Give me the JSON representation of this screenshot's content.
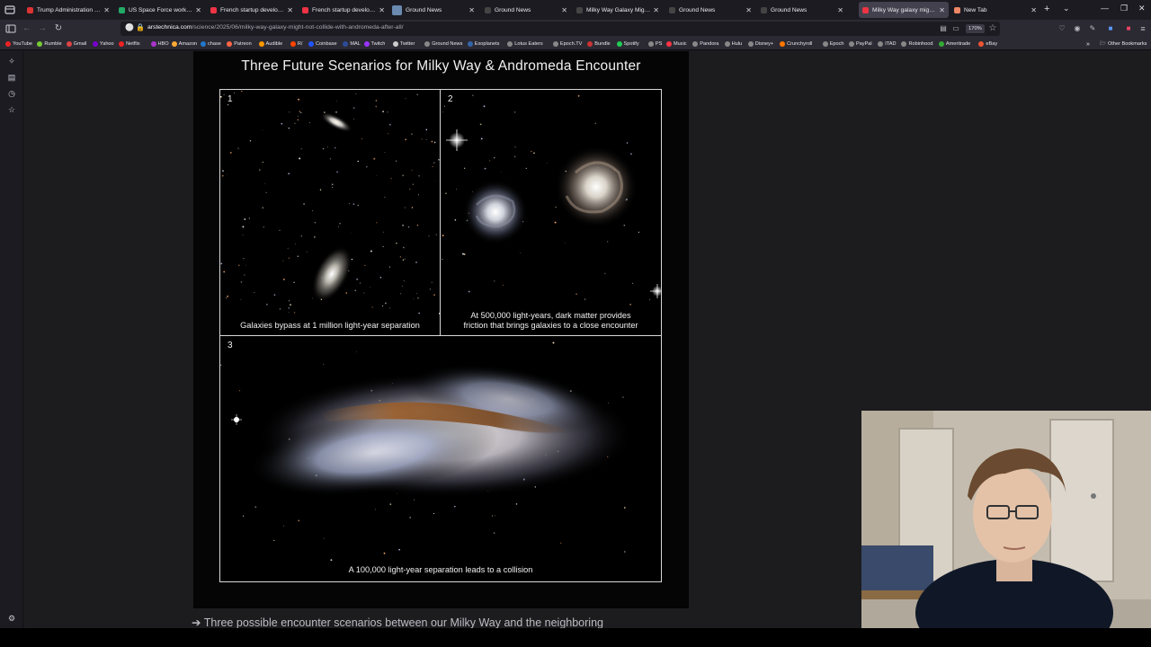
{
  "tabs": [
    {
      "title": "Trump Administration Revo",
      "favicon_color": "#d33",
      "active": false
    },
    {
      "title": "US Space Force working to",
      "favicon_color": "#2a6",
      "active": false
    },
    {
      "title": "French startup developing",
      "favicon_color": "#e34",
      "active": false
    },
    {
      "title": "French startup developing",
      "favicon_color": "#e34",
      "active": false
    },
    {
      "title": "Ground News",
      "favicon_color": "#6a8ab0",
      "active": false
    },
    {
      "title": "Ground News",
      "favicon_color": "#444",
      "active": false
    },
    {
      "title": "Milky Way Galaxy Might No",
      "favicon_color": "#444",
      "active": false
    },
    {
      "title": "Ground News",
      "favicon_color": "#444",
      "active": false
    },
    {
      "title": "Ground News",
      "favicon_color": "#444",
      "active": false
    },
    {
      "title": "Milky Way galaxy might no",
      "favicon_color": "#e34",
      "active": true
    },
    {
      "title": "New Tab",
      "favicon_color": "#e86",
      "active": false
    }
  ],
  "nav": {
    "url_host": "arstechnica.com",
    "url_path": "/science/2025/06/milky-way-galaxy-might-not-collide-with-andromeda-after-all/",
    "zoom": "170%"
  },
  "bookmarks": [
    {
      "label": "YouTube",
      "color": "#e22"
    },
    {
      "label": "Rumble",
      "color": "#7c3"
    },
    {
      "label": "Gmail",
      "color": "#d44"
    },
    {
      "label": "Yahoo",
      "color": "#70c"
    },
    {
      "label": "Netflix",
      "color": "#e22"
    },
    {
      "label": "HBO",
      "color": "#a3c"
    },
    {
      "label": "Amazon",
      "color": "#fa3"
    },
    {
      "label": "chase",
      "color": "#27c"
    },
    {
      "label": "Patreon",
      "color": "#f64"
    },
    {
      "label": "Audible",
      "color": "#f90"
    },
    {
      "label": "R/",
      "color": "#f40"
    },
    {
      "label": "Coinbase",
      "color": "#25f"
    },
    {
      "label": "MAL",
      "color": "#2d4b9a"
    },
    {
      "label": "Twitch",
      "color": "#93f"
    },
    {
      "label": "Twitter",
      "color": "#ccc"
    },
    {
      "label": "Ground News",
      "color": "#888"
    },
    {
      "label": "Exoplanets",
      "color": "#36a"
    },
    {
      "label": "Lotus Eaters",
      "color": "#888"
    },
    {
      "label": "Epoch.TV",
      "color": "#888"
    },
    {
      "label": "Bundle",
      "color": "#c33"
    },
    {
      "label": "Spotify",
      "color": "#2c5"
    },
    {
      "label": "PS",
      "color": "#888"
    },
    {
      "label": "Music",
      "color": "#f34"
    },
    {
      "label": "Pandora",
      "color": "#888"
    },
    {
      "label": "Hulu",
      "color": "#888"
    },
    {
      "label": "Disney+",
      "color": "#888"
    },
    {
      "label": "Crunchyroll",
      "color": "#f70"
    },
    {
      "label": "Epoch",
      "color": "#888"
    },
    {
      "label": "PayPal",
      "color": "#888"
    },
    {
      "label": "ITAD",
      "color": "#888"
    },
    {
      "label": "Robinhood",
      "color": "#888"
    },
    {
      "label": "Ameritrade",
      "color": "#3a3"
    },
    {
      "label": "eBay",
      "color": "#e53"
    }
  ],
  "other_bookmarks": "Other Bookmarks",
  "figure": {
    "title": "Three Future Scenarios for Milky Way & Andromeda Encounter",
    "panels": [
      {
        "number": "1",
        "caption": "Galaxies bypass at 1 million light-year separation"
      },
      {
        "number": "2",
        "caption_line1": "At 500,000 light-years, dark matter provides",
        "caption_line2": "friction that brings galaxies to a close encounter"
      },
      {
        "number": "3",
        "caption": "A 100,000 light-year separation leads to a collision"
      }
    ]
  },
  "article": {
    "caption_partial": "Three possible encounter scenarios between our Milky Way and the neighboring"
  },
  "icons": {
    "tab_menu": "firefox-view-icon",
    "sidebar": [
      "ai-chatbot-icon",
      "bookmarks-panel-icon",
      "history-icon",
      "star-icon",
      "settings-icon"
    ]
  }
}
